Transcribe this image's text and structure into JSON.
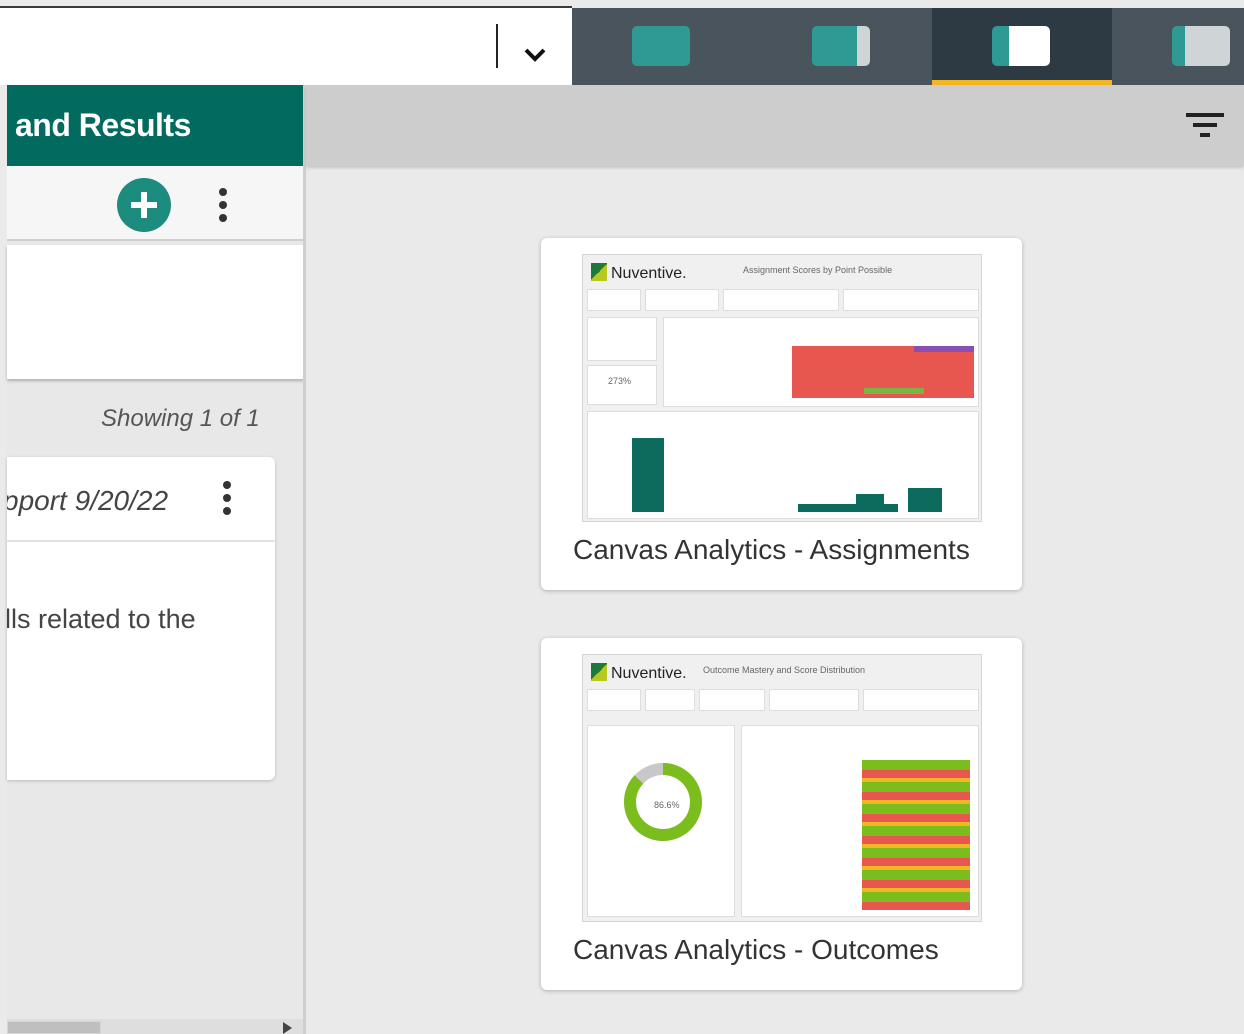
{
  "view_switcher": {
    "options": [
      {
        "icon": "layout-full-icon"
      },
      {
        "icon": "layout-right-narrow-icon"
      },
      {
        "icon": "layout-split-icon",
        "active": true
      },
      {
        "icon": "layout-left-narrow-icon"
      }
    ]
  },
  "left_panel": {
    "title": "and Results",
    "showing_text": "Showing 1 of 1",
    "report_card": {
      "title": "pport 9/20/22",
      "description": "lls related to the"
    }
  },
  "reports": [
    {
      "label": "Canvas Analytics - Assignments",
      "preview": {
        "brand": "Nuventive.",
        "heading": "Assignment Scores by Point Possible",
        "kpi": "273%"
      }
    },
    {
      "label": "Canvas Analytics - Outcomes",
      "preview": {
        "brand": "Nuventive.",
        "heading": "Outcome Mastery and Score Distribution",
        "kpi": "86.6%"
      }
    }
  ],
  "colors": {
    "primary_teal": "#036a5f",
    "accent_yellow": "#f1b626",
    "toolbar_dark": "#4a545c"
  }
}
